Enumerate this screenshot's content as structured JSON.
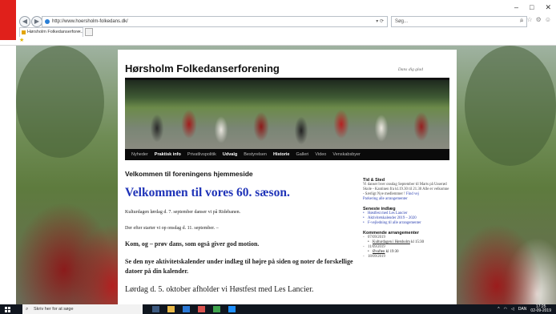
{
  "browser": {
    "address": "http://www.hoersholm-folkedans.dk/",
    "search_placeholder": "Søg...",
    "tab_title": "Hørsholm Folkedanserfore...",
    "win_minimize": "–",
    "win_maximize": "□",
    "win_close": "✕"
  },
  "site": {
    "title": "Hørsholm Folkedanserforening",
    "tagline": "Dans dig glad",
    "nav": [
      {
        "label": "Nyheder"
      },
      {
        "label": "Praktisk info"
      },
      {
        "label": "Privatlivspolitik"
      },
      {
        "label": "Udvalg"
      },
      {
        "label": "Bestyrelsen"
      },
      {
        "label": "Historie"
      },
      {
        "label": "Galleri"
      },
      {
        "label": "Video"
      },
      {
        "label": "Venskabsbyer"
      }
    ]
  },
  "main": {
    "heading": "Velkommen til foreningens hjemmeside",
    "big_heading": "Velkommen til vores 60. sæson.",
    "p1": "Kulturdagen lørdag d. 7. september danser vi på Ridebanen.",
    "p2": "Der efter starter vi op onsdag d. 11. september. –",
    "p3": "Kom, og –  prøv dans, som også giver god motion.",
    "p4": "Se den nye aktivitetskalender under indlæg til højre på siden og noter de forskellige datoer på din kalender.",
    "p5": "Lørdag d. 5. oktober afholder vi Høstfest med Les Lancier."
  },
  "sidebar": {
    "tid_heading": "Tid & Sted",
    "tid_text": "Vi danser hver onsdag September til Marts på Usserød Skole - Kantinen fra kl.19.30 til 21.30 Alle er velkomne - Særligt Nye medlemmer !",
    "tid_link1": "Find vej",
    "tid_link2": "Parkering alle arrangementer",
    "recent_heading": "Seneste indlæg",
    "recent": [
      {
        "label": "Høstfest med Les Lancier"
      },
      {
        "label": "Aktivitetskalender 2019 – 2020"
      },
      {
        "label": "F-vejledning til alle arrangementer"
      }
    ],
    "events_heading": "Kommende arrangementer",
    "ev1_date": "07/09/2019",
    "ev1_title": "Kulturdagen i Hørsholm",
    "ev1_time": "kl 15:30",
    "ev2_date": "11/09/2019",
    "ev2_title": "Øvaften",
    "ev2_time": "kl 19:30",
    "ev3_date": "18/09/2019"
  },
  "taskbar": {
    "search_placeholder": "Skriv her for at søge",
    "lang": "DAN",
    "time": "17:25",
    "date": "02-09-2019"
  }
}
